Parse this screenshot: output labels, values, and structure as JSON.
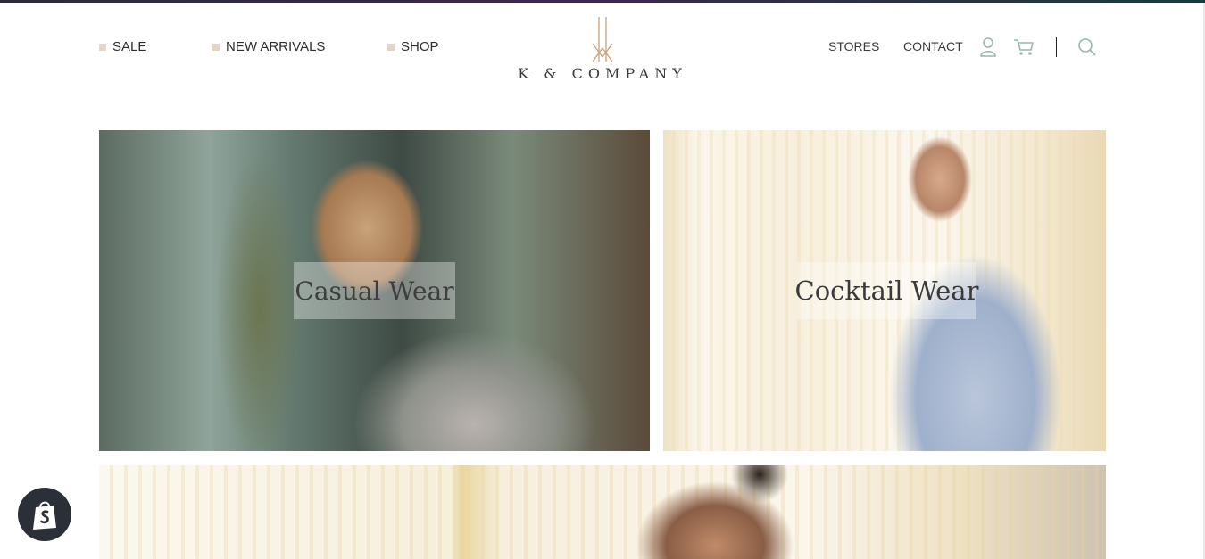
{
  "nav": {
    "left": [
      {
        "label": "SALE"
      },
      {
        "label": "NEW ARRIVALS"
      },
      {
        "label": "SHOP"
      }
    ],
    "right": {
      "stores": "STORES",
      "contact": "CONTACT"
    }
  },
  "logo": {
    "text": "K & COMPANY"
  },
  "tiles": {
    "casual": "Casual Wear",
    "cocktail": "Cocktail Wear"
  },
  "colors": {
    "accent_square": "#e3d6c7",
    "icon_color": "#9ab5ad",
    "logo_gold": "#c9a27a"
  },
  "icons": {
    "account": "user-icon",
    "cart": "cart-icon",
    "search": "search-icon",
    "shopify": "shopify-bag-icon"
  }
}
